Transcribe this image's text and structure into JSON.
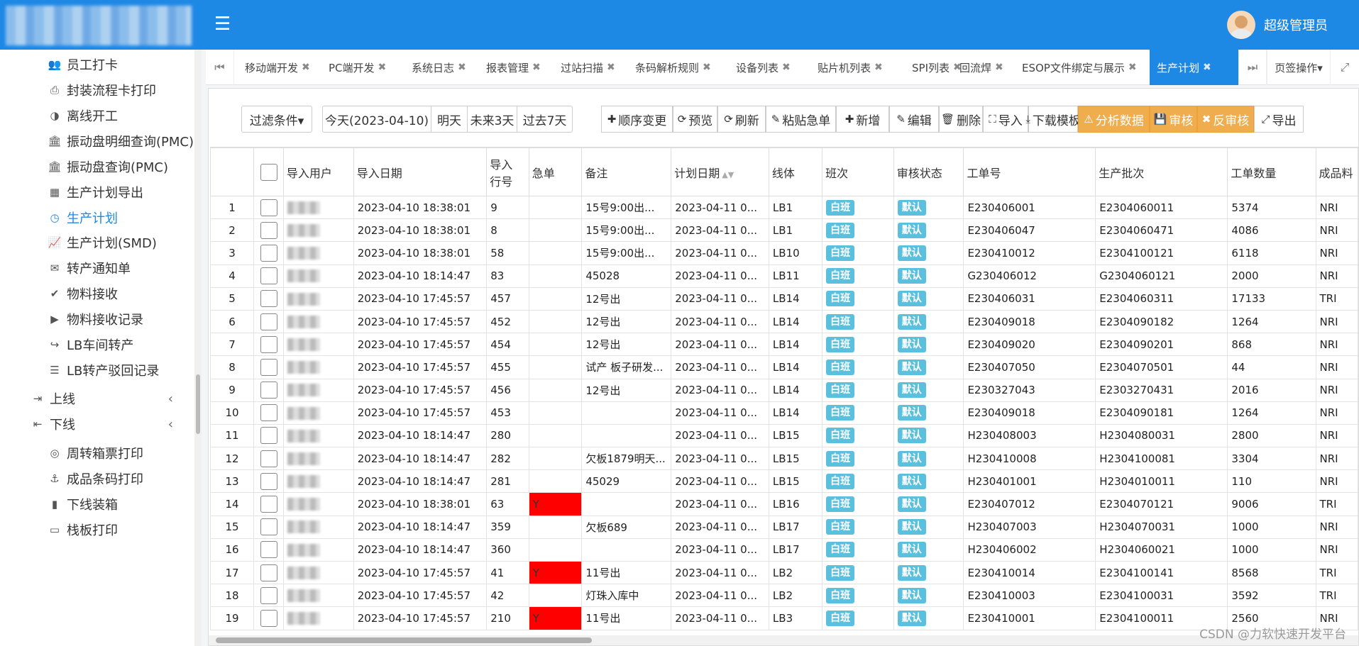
{
  "header": {
    "user_name": "超级管理员"
  },
  "sidebar": {
    "items": [
      {
        "label": "员工打卡",
        "icon": "users-icon",
        "glyph": "👥",
        "level": "sub"
      },
      {
        "label": "封装流程卡打印",
        "icon": "printer-icon",
        "glyph": "⎙",
        "level": "sub"
      },
      {
        "label": "离线开工",
        "icon": "circle-dot-icon",
        "glyph": "◑",
        "level": "sub"
      },
      {
        "label": "振动盘明细查询(PMC)",
        "icon": "bank-icon",
        "glyph": "🏛",
        "level": "sub"
      },
      {
        "label": "振动盘查询(PMC)",
        "icon": "bank-icon",
        "glyph": "🏛",
        "level": "sub"
      },
      {
        "label": "生产计划导出",
        "icon": "calculator-icon",
        "glyph": "▦",
        "level": "sub"
      },
      {
        "label": "生产计划",
        "icon": "clock-icon",
        "glyph": "◷",
        "level": "sub",
        "active": true
      },
      {
        "label": "生产计划(SMD)",
        "icon": "line-chart-icon",
        "glyph": "📈",
        "level": "sub"
      },
      {
        "label": "转产通知单",
        "icon": "envelope-icon",
        "glyph": "✉",
        "level": "sub"
      },
      {
        "label": "物料接收",
        "icon": "check-circle-icon",
        "glyph": "✔",
        "level": "sub"
      },
      {
        "label": "物料接收记录",
        "icon": "play-square-icon",
        "glyph": "▶",
        "level": "sub"
      },
      {
        "label": "LB车间转产",
        "icon": "share-icon",
        "glyph": "↪",
        "level": "sub"
      },
      {
        "label": "LB转产驳回记录",
        "icon": "list-icon",
        "glyph": "☰",
        "level": "sub"
      },
      {
        "label": "上线",
        "icon": "sign-in-icon",
        "glyph": "⇥",
        "level": "top",
        "arrow": "‹"
      },
      {
        "label": "下线",
        "icon": "sign-out-icon",
        "glyph": "⇤",
        "level": "top",
        "arrow": "‹"
      },
      {
        "label": "周转箱票打印",
        "icon": "circle-o-icon",
        "glyph": "◎",
        "level": "sub"
      },
      {
        "label": "成品条码打印",
        "icon": "anchor-icon",
        "glyph": "⚓",
        "level": "sub"
      },
      {
        "label": "下线装箱",
        "icon": "tablet-icon",
        "glyph": "▮",
        "level": "sub"
      },
      {
        "label": "栈板打印",
        "icon": "credit-card-icon",
        "glyph": "▭",
        "level": "sub"
      }
    ]
  },
  "tabs": {
    "items": [
      {
        "label": "移动端开发"
      },
      {
        "label": "PC端开发"
      },
      {
        "label": "系统日志"
      },
      {
        "label": "报表管理"
      },
      {
        "label": "过站扫描"
      },
      {
        "label": "条码解析规则"
      },
      {
        "label": "设备列表"
      },
      {
        "label": "贴片机列表"
      },
      {
        "label": "SPI列表"
      },
      {
        "label": "回流焊"
      },
      {
        "label": "ESOP文件绑定与展示"
      },
      {
        "label": "生产计划",
        "active": true
      }
    ],
    "close_glyph": "✖",
    "prev_glyph": "⏮",
    "next_glyph": "⏭",
    "page_ops_label": "页签操作▾",
    "expand_glyph": "⤢"
  },
  "toolbar": {
    "filter_label": "过滤条件▾",
    "date_buttons": [
      "今天(2023-04-10)",
      "明天",
      "未来3天",
      "过去7天"
    ],
    "actions": [
      {
        "label": "顺序变更",
        "glyph": "✚",
        "style": "default"
      },
      {
        "label": "预览",
        "glyph": "⟳",
        "style": "default"
      },
      {
        "label": "刷新",
        "glyph": "⟳",
        "style": "default"
      },
      {
        "label": "粘贴急单",
        "glyph": "✎",
        "style": "default"
      },
      {
        "label": "新增",
        "glyph": "✚",
        "style": "default"
      },
      {
        "label": "编辑",
        "glyph": "✎",
        "style": "default"
      },
      {
        "label": "删除",
        "glyph": "🗑",
        "style": "default"
      },
      {
        "label": "导入",
        "glyph": "⛶",
        "style": "default"
      },
      {
        "label": "下载模板",
        "glyph": "⤓",
        "style": "default"
      },
      {
        "label": "分析数据",
        "glyph": "⚠",
        "style": "warning"
      },
      {
        "label": "审核",
        "glyph": "💾",
        "style": "warning"
      },
      {
        "label": "反审核",
        "glyph": "✖",
        "style": "warning"
      },
      {
        "label": "导出",
        "glyph": "⤢",
        "style": "default"
      }
    ]
  },
  "table": {
    "headers": [
      "导入用户",
      "导入日期",
      "导入\n行号",
      "急单",
      "备注",
      "计划日期",
      "线体",
      "班次",
      "审核状态",
      "工单号",
      "生产批次",
      "工单数量",
      "成品料"
    ],
    "sort_glyph": "▲▼",
    "rows": [
      {
        "no": "1",
        "date": "2023-04-10 18:38:01",
        "line_no": "9",
        "urgent": "",
        "note": "15号9:00出...",
        "plan": "2023-04-11 0...",
        "line": "LB1",
        "shift": "白班",
        "status": "默认",
        "wo": "E230406001",
        "batch": "E2304060011",
        "qty": "5374",
        "fg": "NRI"
      },
      {
        "no": "2",
        "date": "2023-04-10 18:38:01",
        "line_no": "8",
        "urgent": "",
        "note": "15号9:00出...",
        "plan": "2023-04-11 0...",
        "line": "LB1",
        "shift": "白班",
        "status": "默认",
        "wo": "E230406047",
        "batch": "E2304060471",
        "qty": "4086",
        "fg": "NRI"
      },
      {
        "no": "3",
        "date": "2023-04-10 18:38:01",
        "line_no": "58",
        "urgent": "",
        "note": "15号9:00出...",
        "plan": "2023-04-11 0...",
        "line": "LB10",
        "shift": "白班",
        "status": "默认",
        "wo": "E230410012",
        "batch": "E2304100121",
        "qty": "6118",
        "fg": "NRI"
      },
      {
        "no": "4",
        "date": "2023-04-10 18:14:47",
        "line_no": "83",
        "urgent": "",
        "note": "45028",
        "plan": "2023-04-11 0...",
        "line": "LB11",
        "shift": "白班",
        "status": "默认",
        "wo": "G230406012",
        "batch": "G2304060121",
        "qty": "2000",
        "fg": "NRI"
      },
      {
        "no": "5",
        "date": "2023-04-10 17:45:57",
        "line_no": "457",
        "urgent": "",
        "note": "12号出",
        "plan": "2023-04-11 0...",
        "line": "LB14",
        "shift": "白班",
        "status": "默认",
        "wo": "E230406031",
        "batch": "E2304060311",
        "qty": "17133",
        "fg": "TRI"
      },
      {
        "no": "6",
        "date": "2023-04-10 17:45:57",
        "line_no": "452",
        "urgent": "",
        "note": "12号出",
        "plan": "2023-04-11 0...",
        "line": "LB14",
        "shift": "白班",
        "status": "默认",
        "wo": "E230409018",
        "batch": "E2304090182",
        "qty": "1264",
        "fg": "NRI"
      },
      {
        "no": "7",
        "date": "2023-04-10 17:45:57",
        "line_no": "454",
        "urgent": "",
        "note": "12号出",
        "plan": "2023-04-11 0...",
        "line": "LB14",
        "shift": "白班",
        "status": "默认",
        "wo": "E230409020",
        "batch": "E2304090201",
        "qty": "868",
        "fg": "NRI"
      },
      {
        "no": "8",
        "date": "2023-04-10 17:45:57",
        "line_no": "455",
        "urgent": "",
        "note": "试产 板子研发...",
        "plan": "2023-04-11 0...",
        "line": "LB14",
        "shift": "白班",
        "status": "默认",
        "wo": "E230407050",
        "batch": "E2304070501",
        "qty": "44",
        "fg": "NRI"
      },
      {
        "no": "9",
        "date": "2023-04-10 17:45:57",
        "line_no": "456",
        "urgent": "",
        "note": "12号出",
        "plan": "2023-04-11 0...",
        "line": "LB14",
        "shift": "白班",
        "status": "默认",
        "wo": "E230327043",
        "batch": "E2303270431",
        "qty": "2016",
        "fg": "NRI"
      },
      {
        "no": "10",
        "date": "2023-04-10 17:45:57",
        "line_no": "453",
        "urgent": "",
        "note": "",
        "plan": "2023-04-11 0...",
        "line": "LB14",
        "shift": "白班",
        "status": "默认",
        "wo": "E230409018",
        "batch": "E2304090181",
        "qty": "1264",
        "fg": "NRI"
      },
      {
        "no": "11",
        "date": "2023-04-10 18:14:47",
        "line_no": "280",
        "urgent": "",
        "note": "",
        "plan": "2023-04-11 0...",
        "line": "LB15",
        "shift": "白班",
        "status": "默认",
        "wo": "H230408003",
        "batch": "H2304080031",
        "qty": "2800",
        "fg": "NRI"
      },
      {
        "no": "12",
        "date": "2023-04-10 18:14:47",
        "line_no": "282",
        "urgent": "",
        "note": "欠板1879明天...",
        "plan": "2023-04-11 0...",
        "line": "LB15",
        "shift": "白班",
        "status": "默认",
        "wo": "H230410008",
        "batch": "H2304100081",
        "qty": "3304",
        "fg": "NRI"
      },
      {
        "no": "13",
        "date": "2023-04-10 18:14:47",
        "line_no": "281",
        "urgent": "",
        "note": "45029",
        "plan": "2023-04-11 0...",
        "line": "LB15",
        "shift": "白班",
        "status": "默认",
        "wo": "H230401001",
        "batch": "H2304010011",
        "qty": "110",
        "fg": "NRI"
      },
      {
        "no": "14",
        "date": "2023-04-10 18:38:01",
        "line_no": "63",
        "urgent": "Y",
        "note": "",
        "plan": "2023-04-11 0...",
        "line": "LB16",
        "shift": "白班",
        "status": "默认",
        "wo": "E230407012",
        "batch": "E2304070121",
        "qty": "9006",
        "fg": "TRI"
      },
      {
        "no": "15",
        "date": "2023-04-10 18:14:47",
        "line_no": "359",
        "urgent": "",
        "note": "欠板689",
        "plan": "2023-04-11 0...",
        "line": "LB17",
        "shift": "白班",
        "status": "默认",
        "wo": "H230407003",
        "batch": "H2304070031",
        "qty": "1000",
        "fg": "NRI"
      },
      {
        "no": "16",
        "date": "2023-04-10 18:14:47",
        "line_no": "360",
        "urgent": "",
        "note": "",
        "plan": "2023-04-11 0...",
        "line": "LB17",
        "shift": "白班",
        "status": "默认",
        "wo": "H230406002",
        "batch": "H2304060021",
        "qty": "1000",
        "fg": "NRI"
      },
      {
        "no": "17",
        "date": "2023-04-10 17:45:57",
        "line_no": "41",
        "urgent": "Y",
        "note": "11号出",
        "plan": "2023-04-11 0...",
        "line": "LB2",
        "shift": "白班",
        "status": "默认",
        "wo": "E230410014",
        "batch": "E2304100141",
        "qty": "8568",
        "fg": "TRI"
      },
      {
        "no": "18",
        "date": "2023-04-10 17:45:57",
        "line_no": "42",
        "urgent": "",
        "note": "灯珠入库中",
        "plan": "2023-04-11 0...",
        "line": "LB2",
        "shift": "白班",
        "status": "默认",
        "wo": "E230410003",
        "batch": "E2304100031",
        "qty": "3592",
        "fg": "TRI"
      },
      {
        "no": "19",
        "date": "2023-04-10 17:45:57",
        "line_no": "210",
        "urgent": "Y",
        "note": "11号出",
        "plan": "2023-04-11 0...",
        "line": "LB3",
        "shift": "白班",
        "status": "默认",
        "wo": "E230410001",
        "batch": "E2304100011",
        "qty": "2560",
        "fg": "NRI"
      }
    ]
  },
  "watermark": "CSDN @力软快速开发平台",
  "colors": {
    "brand": "#1e88e5",
    "warning": "#f0ad4e",
    "label_info": "#5bc0de",
    "urgent": "#ff0000"
  }
}
